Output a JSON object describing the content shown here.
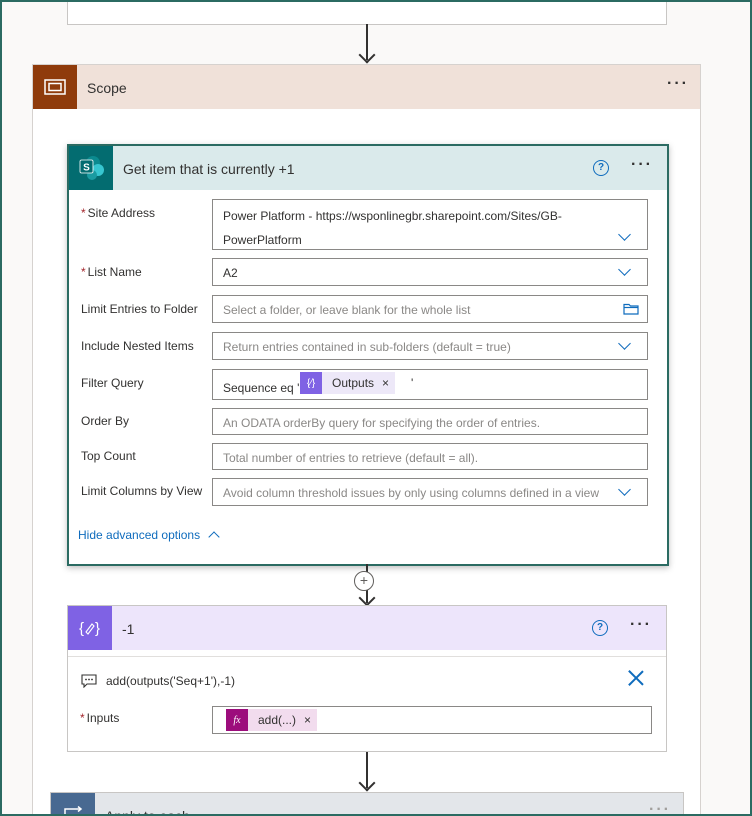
{
  "scope": {
    "title": "Scope",
    "more": "···"
  },
  "sharepoint_action": {
    "title": "Get item that is currently +1",
    "help": "?",
    "more": "···",
    "fields": {
      "site_address": {
        "label": "Site Address",
        "required_mark": "*",
        "value_line1": "Power Platform - https://wsponlinegbr.sharepoint.com/Sites/GB-",
        "value_line2": "PowerPlatform"
      },
      "list_name": {
        "label": "List Name",
        "required_mark": "*",
        "value": "A2"
      },
      "limit_entries": {
        "label": "Limit Entries to Folder",
        "placeholder": "Select a folder, or leave blank for the whole list"
      },
      "include_nested": {
        "label": "Include Nested Items",
        "placeholder": "Return entries contained in sub-folders (default = true)"
      },
      "filter_query": {
        "label": "Filter Query",
        "prefix": "Sequence eq '",
        "token_label": "Outputs",
        "token_remove": "×",
        "suffix": "'"
      },
      "order_by": {
        "label": "Order By",
        "placeholder": "An ODATA orderBy query for specifying the order of entries."
      },
      "top_count": {
        "label": "Top Count",
        "placeholder": "Total number of entries to retrieve (default = all)."
      },
      "limit_columns": {
        "label": "Limit Columns by View",
        "placeholder": "Avoid column threshold issues by only using columns defined in a view"
      }
    },
    "hide_advanced_label": "Hide advanced options"
  },
  "insert_step": {
    "plus": "+"
  },
  "compose_action": {
    "title": "-1",
    "help": "?",
    "more": "···",
    "comment": "add(outputs('Seq+1'),-1)",
    "inputs": {
      "label": "Inputs",
      "required_mark": "*",
      "token_label": "add(...)",
      "token_icon": "fx",
      "token_remove": "×"
    }
  },
  "apply_to_each": {
    "title": "Apply to each",
    "more": "···"
  },
  "colors": {
    "scope": "#8f3b0b",
    "sharepoint": "#036c70",
    "compose": "#7f62e4",
    "expression": "#9c0d7c",
    "apply_to_each": "#486991",
    "link": "#0f6cbd"
  }
}
